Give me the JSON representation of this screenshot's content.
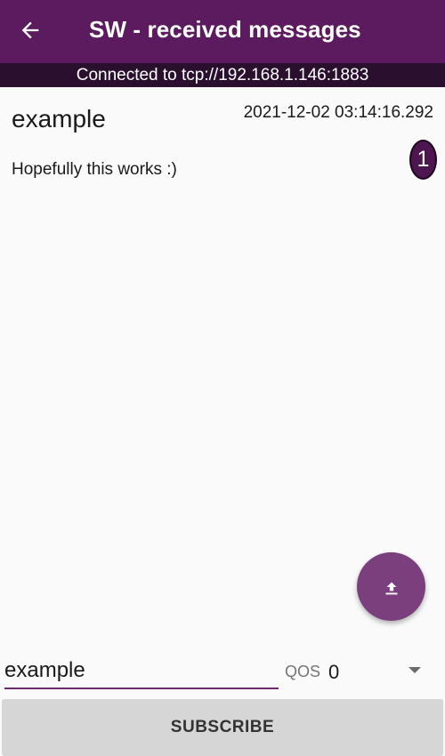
{
  "app_bar": {
    "title": "SW - received messages",
    "back_icon": "arrow-left-icon"
  },
  "status": {
    "text": "Connected to tcp://192.168.1.146:1883"
  },
  "messages": [
    {
      "topic": "example",
      "timestamp": "2021-12-02 03:14:16.292",
      "body": "Hopefully this works :)",
      "qos_badge": "1"
    }
  ],
  "fab": {
    "icon": "upload-icon"
  },
  "subscribe_form": {
    "topic_value": "example",
    "qos_label": "QOS",
    "qos_value": "0",
    "button_label": "SUBSCRIBE"
  },
  "colors": {
    "primary": "#5c1b5e",
    "status_bar": "#2b0f2f",
    "accent": "#7a3f7c",
    "badge": "#4e1650",
    "background": "#fafafa"
  }
}
